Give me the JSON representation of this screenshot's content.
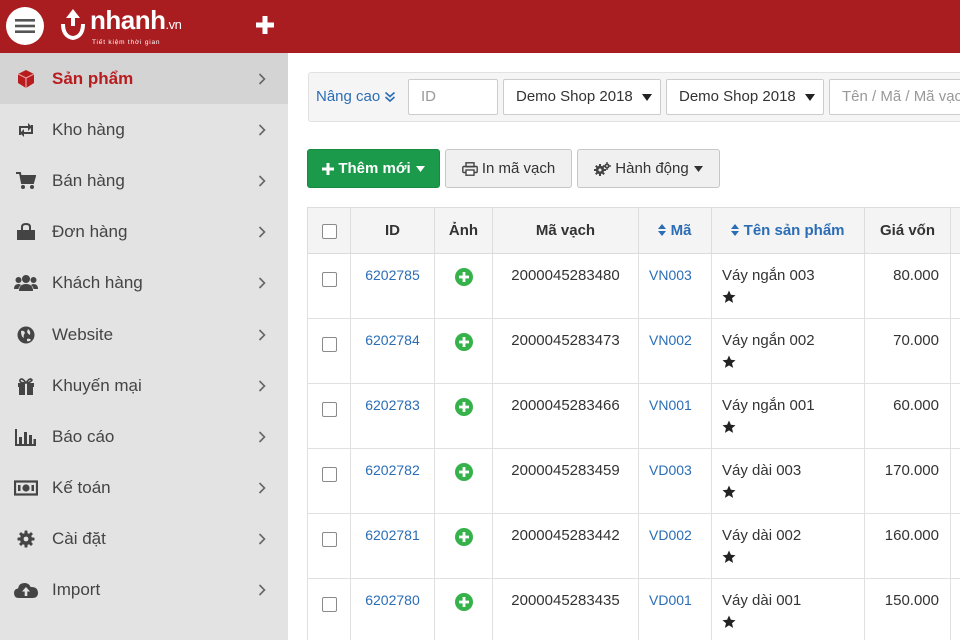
{
  "brand": {
    "name": "nhanh",
    "tld": ".vn",
    "tagline": "Tiết kiệm thời gian"
  },
  "colors": {
    "header": "#a91c1f",
    "sidebar": "#e3e3e3",
    "active_text": "#b91c1f",
    "link": "#2a6db5",
    "primary_button": "#1a9a4a"
  },
  "sidebar": {
    "items": [
      {
        "label": "Sản phẩm",
        "icon": "cube-icon",
        "active": true
      },
      {
        "label": "Kho hàng",
        "icon": "retweet-icon",
        "active": false
      },
      {
        "label": "Bán hàng",
        "icon": "cart-icon",
        "active": false
      },
      {
        "label": "Đơn hàng",
        "icon": "shopping-bag-icon",
        "active": false
      },
      {
        "label": "Khách hàng",
        "icon": "users-icon",
        "active": false
      },
      {
        "label": "Website",
        "icon": "globe-icon",
        "active": false
      },
      {
        "label": "Khuyến mại",
        "icon": "gift-icon",
        "active": false
      },
      {
        "label": "Báo cáo",
        "icon": "bar-chart-icon",
        "active": false
      },
      {
        "label": "Kế toán",
        "icon": "money-icon",
        "active": false
      },
      {
        "label": "Cài đặt",
        "icon": "gear-icon",
        "active": false
      },
      {
        "label": "Import",
        "icon": "cloud-upload-icon",
        "active": false
      }
    ]
  },
  "filters": {
    "advanced_label": "Nâng cao",
    "id_placeholder": "ID",
    "store1": "Demo Shop 2018",
    "store2": "Demo Shop 2018",
    "search_placeholder": "Tên / Mã / Mã vạch"
  },
  "toolbar": {
    "add_label": "Thêm mới",
    "print_label": "In mã vạch",
    "action_label": "Hành động"
  },
  "table": {
    "headers": {
      "id": "ID",
      "image": "Ảnh",
      "barcode": "Mã vạch",
      "code": "Mã",
      "name": "Tên sản phẩm",
      "cost": "Giá vốn"
    },
    "rows": [
      {
        "id": "6202785",
        "barcode": "2000045283480",
        "code": "VN003",
        "name": "Váy ngắn 003",
        "cost": "80.000"
      },
      {
        "id": "6202784",
        "barcode": "2000045283473",
        "code": "VN002",
        "name": "Váy ngắn 002",
        "cost": "70.000"
      },
      {
        "id": "6202783",
        "barcode": "2000045283466",
        "code": "VN001",
        "name": "Váy ngắn 001",
        "cost": "60.000"
      },
      {
        "id": "6202782",
        "barcode": "2000045283459",
        "code": "VD003",
        "name": "Váy dài 003",
        "cost": "170.000"
      },
      {
        "id": "6202781",
        "barcode": "2000045283442",
        "code": "VD002",
        "name": "Váy dài 002",
        "cost": "160.000"
      },
      {
        "id": "6202780",
        "barcode": "2000045283435",
        "code": "VD001",
        "name": "Váy dài 001",
        "cost": "150.000"
      }
    ]
  }
}
